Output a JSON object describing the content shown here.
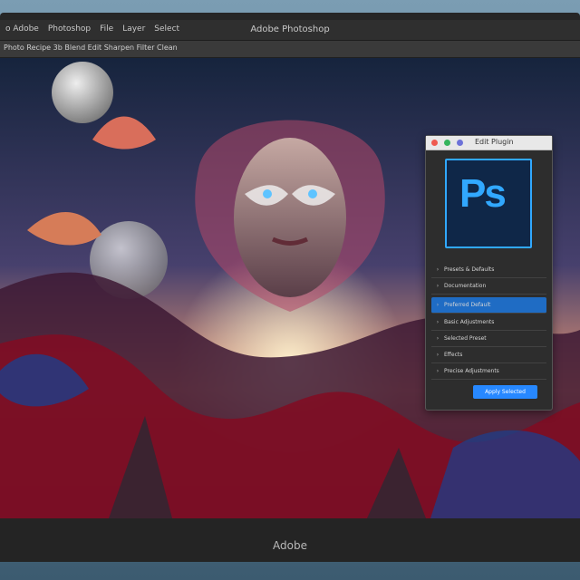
{
  "window": {
    "title": "Adobe Photoshop"
  },
  "menu": [
    "o Adobe",
    "Photoshop",
    "File",
    "Layer",
    "Select"
  ],
  "toolbar": {
    "text": "Photo Recipe 3b Blend Edit Sharpen Filter Clean"
  },
  "artwork": {
    "type": "fantasy-portrait"
  },
  "panel": {
    "title": "Edit Plugin",
    "logo": "Ps",
    "section": "Presets & Defaults",
    "section2": "Documentation",
    "items": [
      "Preferred Default",
      "Basic Adjustments",
      "Selected Preset",
      "Effects",
      "Precise Adjustments"
    ],
    "button": "Apply Selected"
  },
  "footer": {
    "brand": "Adobe"
  },
  "colors": {
    "accent": "#31a8ff",
    "button": "#2788ff",
    "active": "#1f6cc4"
  }
}
